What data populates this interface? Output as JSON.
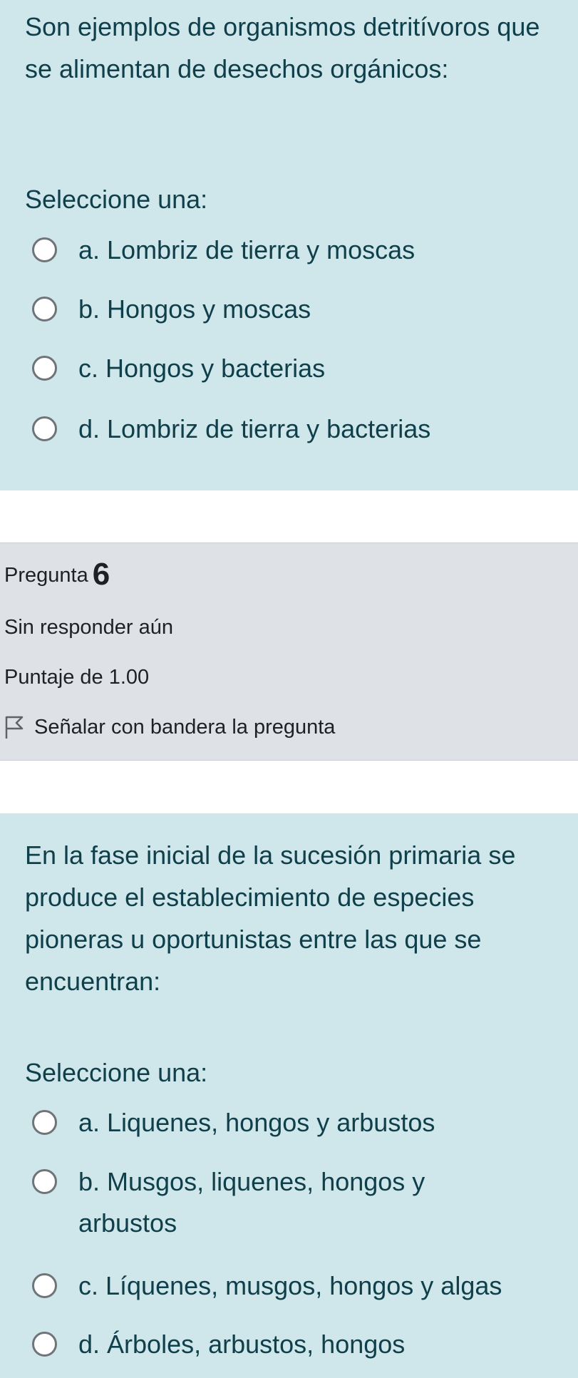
{
  "question5": {
    "text": "Son ejemplos de organismos detritívoros que se alimentan de desechos orgánicos:",
    "prompt": "Seleccione una:",
    "options": [
      "a. Lombriz de tierra y moscas",
      "b. Hongos y moscas",
      "c. Hongos y bacterias",
      "d. Lombriz de tierra y bacterias"
    ]
  },
  "question6_info": {
    "label": "Pregunta",
    "number": "6",
    "status": "Sin responder aún",
    "score": "Puntaje de 1.00",
    "flag_label": "Señalar con bandera la pregunta",
    "flag_icon": "flag-outline-icon"
  },
  "question6": {
    "text": "En la fase inicial de la sucesión primaria se produce el establecimiento de especies pioneras u oportunistas entre las que se encuentran:",
    "prompt": "Seleccione una:",
    "options": [
      "a. Liquenes, hongos y arbustos",
      "b. Musgos, liquenes, hongos y arbustos",
      "c. Líquenes, musgos, hongos y algas",
      "d. Árboles, arbustos, hongos"
    ]
  },
  "colors": {
    "question_background": "#cfe6ea",
    "info_background": "#dee2e6",
    "question_text": "#0f3f4a",
    "radio_border": "#6f7478"
  }
}
